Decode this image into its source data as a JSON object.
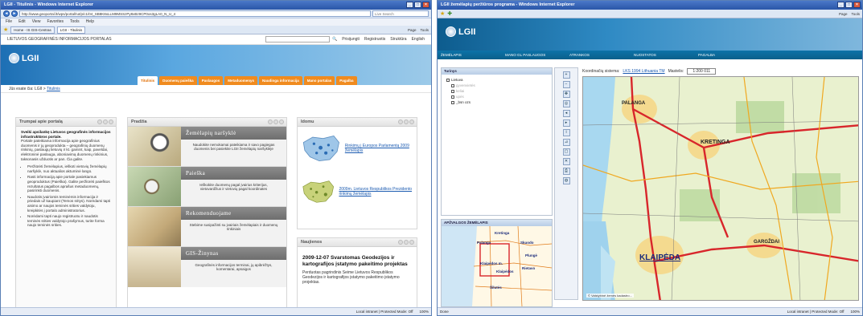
{
  "window1": {
    "title": "LGII - Titulinis - Windows Internet Explorer",
    "url": "http://www.geoportal.lt/wps/portal/!ut/p/c1/04_SB8K8xLLM9MSSzPy8xBz9CP0os3gLA0_N_U_4",
    "search_placeholder": "Live Search",
    "menu": [
      "File",
      "Edit",
      "View",
      "Favorites",
      "Tools",
      "Help"
    ],
    "tabs": [
      "Home - IS GIS-Centras",
      "LGII - Titulinis"
    ],
    "tools": [
      "Page",
      "Tools"
    ],
    "header_text": "LIETUVOS GEOGRAFINĖS INFORMACIJOS PORTALAS",
    "top_links": [
      "Prisijungti",
      "Registruotis",
      "Struktūra",
      "English"
    ],
    "logo": "LGII",
    "nav": [
      "Titulinis",
      "Duomenų paieška",
      "Paslaugos",
      "Metaduomenys",
      "Naudinga informacija",
      "Mano portalas",
      "Pagalba"
    ],
    "breadcrumb_prefix": "Jūs esate čia: LGII >",
    "breadcrumb_current": "Titulinis",
    "about": {
      "heading": "Trumpai apie portalą",
      "lead": "Sveiki apsilankę Lietuvos geografinės informacijos infrastruktūros portale.",
      "body": "Portale pateikiama informacija apie geografinius duomenis ir jų geoprodukta – geografinių duomenų rinkinių, paslaugų lietuvių ir kt. gamint, kaip, paveldai, elektroninė paslauga, aboniavimą duomenų rinkinius, taksonasis užduotis ar pan. Čia galite.",
      "bullets": [
        "Peržiūrėti žemėlapius, ieškoti vietovių žemėlapių naršyklė, nuo aktualios aktuminė lango.",
        "Rasti informaciją apie portale pasiekiamus geoproduktus (Paieška). Galite peržiūrėti paieškos rezultatus pagalbos aprašus metaduomenų, pasirinkti duomenis.",
        "Naudotis įvairiomis teminėmis informacija ir priedais už kaupiant (Temos sritys). Norėdami tapti aisimo ar naujos teminės srities valdytoju, kreipkitės į portalo administratorius.",
        "Norėdami tapti naujo registruotu ir naudotis teminės srities valdytojo prašymus, turite forma naujo teminės srities."
      ]
    },
    "features": {
      "heading": "Pradžia",
      "items": [
        {
          "title": "Žemėlapių naršyklė",
          "desc": "Naudokite nemokamai pateikiama ir savo pagiegas duomenis bei pasiekite LGII žemėlapių naršyklėje"
        },
        {
          "title": "Paieška",
          "desc": "Ieškokite duomenų pagal įvairius kriterijus, vietovardžius ir vietovių pagal koordinates"
        },
        {
          "title": "Rekomenduojame",
          "desc": "Stebime susipažinti su įvairiais žemėlapiais ir duomenų rinkiniais"
        },
        {
          "title": "GIS-Žinynas",
          "desc": "Geografinės informacijos terminai, jų apibrėžtys, komentarai, apsaigos"
        }
      ]
    },
    "maps": {
      "heading": "Idomu",
      "items": [
        "Rinkimų į Europos Parlamentą 2009 žemėlapis",
        "2009m. Lietuvos Respublikos Prezidento rinkimų žemėlapis"
      ]
    },
    "news": {
      "heading": "Naujienos",
      "date_title": "2009-12-07 Svarstomas Geodezijos ir kartografijos įstatymo pakeitimo projektas",
      "body": "Perduotas pagrindinis Seime Lietuvos Respublikos Geodezijos ir kartografijos įstatymo pakeitimo įstatymo projektas."
    },
    "status": {
      "zone": "Local intranet | Protected Mode: Off",
      "zoom": "100%"
    }
  },
  "window2": {
    "title": "LGII žemėlapių peržiūros programa - Windows Internet Explorer",
    "tools": [
      "Page",
      "Tools"
    ],
    "logo": "LGII",
    "menu": [
      "ŽEMĖLAPIS",
      "MANO GL PASLAUGOS",
      "ATRANKOS",
      "NUOSTATOS",
      "PAGALBA"
    ],
    "panel_title": "Turinys",
    "tree": [
      "Lietuva",
      "gyvenvietės",
      "keliai",
      "upės",
      "_bsn ozs"
    ],
    "coord_label": "Koordinačių sistema:",
    "coord_value": "LKS 1994 Lithuania TM",
    "scale_label": "Mastelis:",
    "scale_value": "1:200 011",
    "overview_title": "APŽVALGOS ŽEMĖLAPIS",
    "overview_labels": [
      "Kretinga",
      "Palanga",
      "Skuodo",
      "Klaipėdos m.",
      "Klaipėdos",
      "Šilutės",
      "Plungė",
      "Rietavo"
    ],
    "map_labels": [
      "PALANGA",
      "KRETINGA",
      "KLAIPĖDA",
      "GARGŽDAI"
    ],
    "map_attribution": "© Valstybinė žemės kadastro...",
    "status": {
      "left": "Done",
      "zone": "Local intranet | Protected Mode: Off",
      "zoom": "100%"
    },
    "colors": {
      "accent": "#0a6ea8",
      "road": "#d8262b"
    }
  }
}
